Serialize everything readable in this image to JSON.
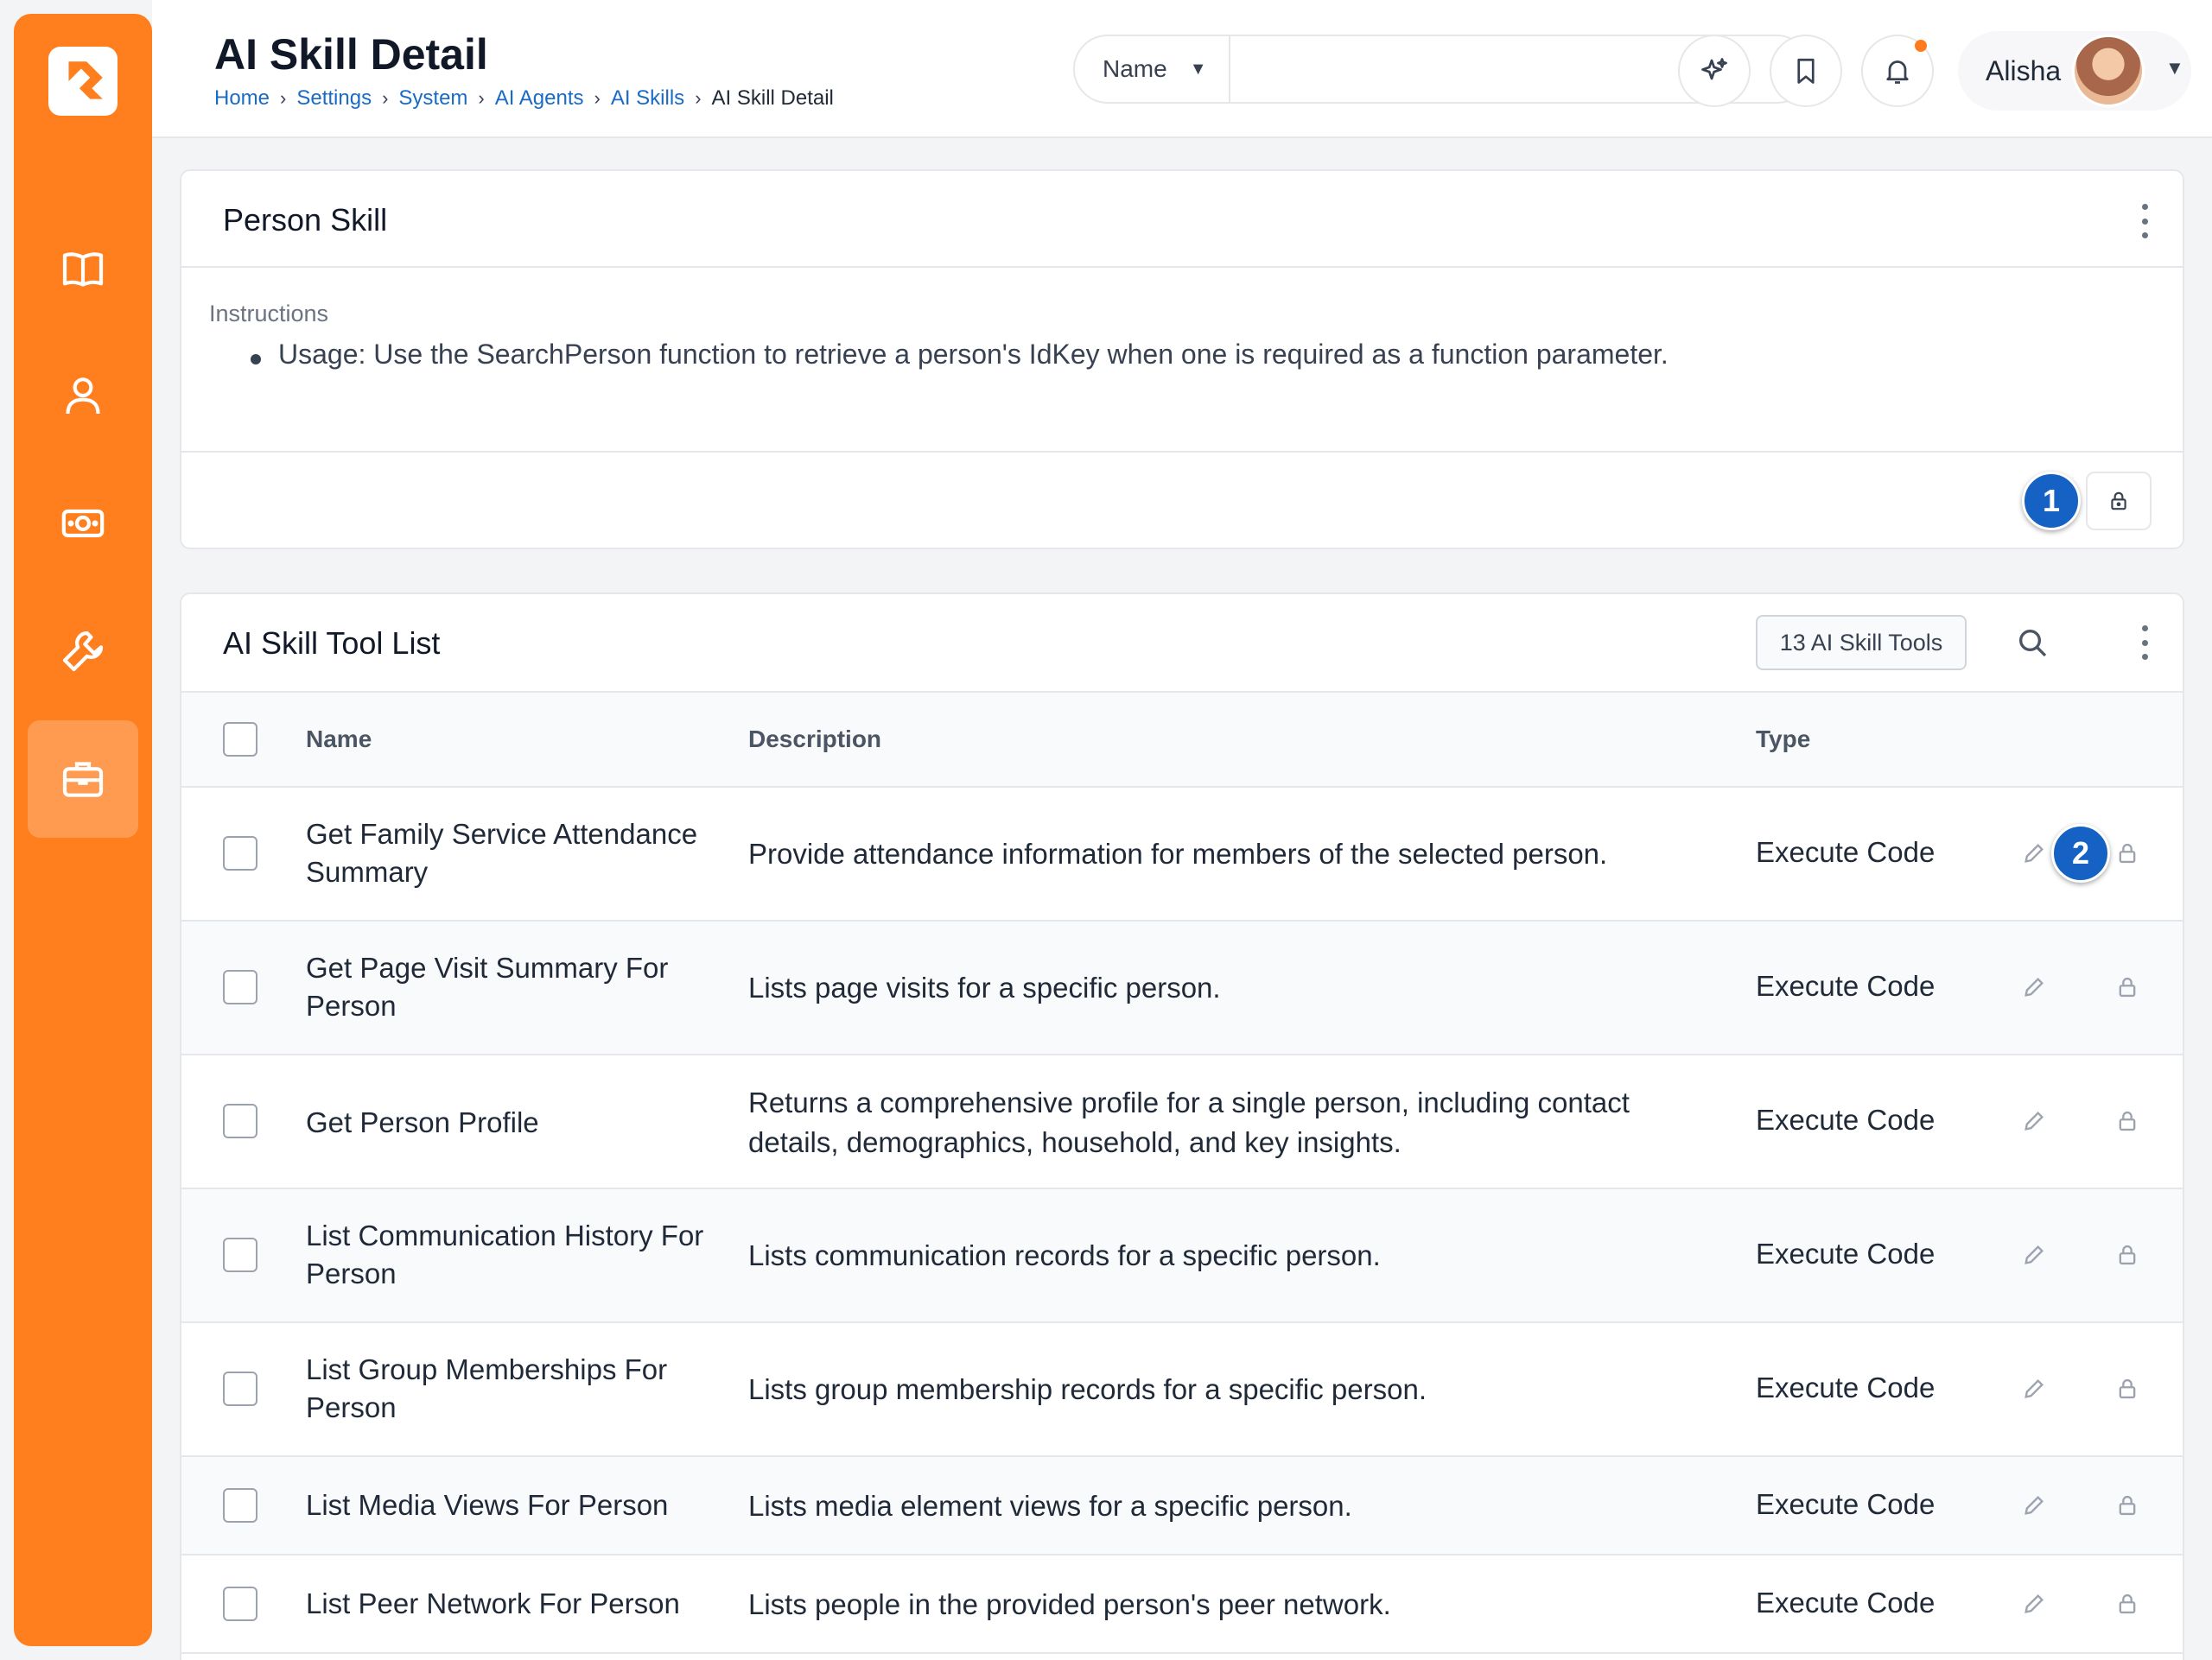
{
  "header": {
    "title": "AI Skill Detail",
    "breadcrumbs": [
      "Home",
      "Settings",
      "System",
      "AI Agents",
      "AI Skills"
    ],
    "breadcrumb_current": "AI Skill Detail",
    "search_select": "Name",
    "search_value": "",
    "user_name": "Alisha"
  },
  "colors": {
    "accent": "#ff7f1f",
    "link": "#1a6bc4",
    "badge": "#1662c4"
  },
  "sidebar": {
    "items": [
      {
        "icon": "book-icon"
      },
      {
        "icon": "person-icon"
      },
      {
        "icon": "money-icon"
      },
      {
        "icon": "wrench-icon"
      },
      {
        "icon": "briefcase-icon",
        "active": true
      }
    ]
  },
  "skill_card": {
    "title": "Person Skill",
    "instructions_label": "Instructions",
    "instruction_item": "Usage: Use the SearchPerson function to retrieve a person's IdKey when one is required as a function parameter.",
    "callout_1": "1"
  },
  "tool_list": {
    "title": "AI Skill Tool List",
    "count_label": "13 AI Skill Tools",
    "columns": {
      "name": "Name",
      "description": "Description",
      "type": "Type"
    },
    "callout_2": "2",
    "rows": [
      {
        "name": "Get Family Service Attendance Summary",
        "description": "Provide attendance information for members of the selected person.",
        "type": "Execute Code"
      },
      {
        "name": "Get Page Visit Summary For Person",
        "description": "Lists page visits for a specific person.",
        "type": "Execute Code"
      },
      {
        "name": "Get Person Profile",
        "description": "Returns a comprehensive profile for a single person, including contact details, demographics, household, and key insights.",
        "type": "Execute Code"
      },
      {
        "name": "List Communication History For Person",
        "description": "Lists communication records for a specific person.",
        "type": "Execute Code"
      },
      {
        "name": "List Group Memberships For Person",
        "description": "Lists group membership records for a specific person.",
        "type": "Execute Code"
      },
      {
        "name": "List Media Views For Person",
        "description": "Lists media element views for a specific person.",
        "type": "Execute Code"
      },
      {
        "name": "List Peer Network For Person",
        "description": "Lists people in the provided person's peer network.",
        "type": "Execute Code"
      }
    ]
  }
}
